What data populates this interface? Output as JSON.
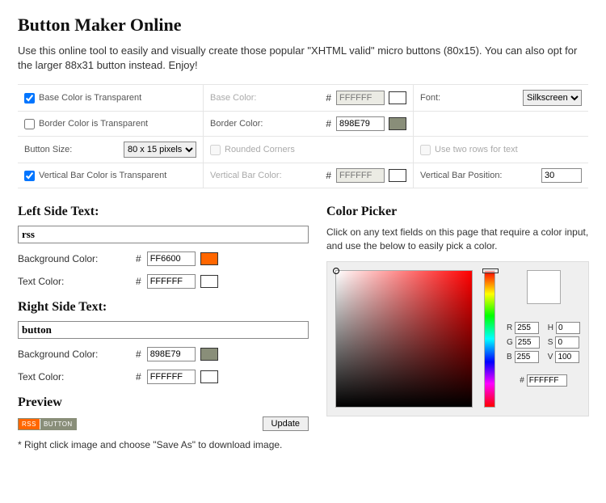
{
  "title": "Button Maker Online",
  "intro": "Use this online tool to easily and visually create those popular \"XHTML valid\" micro buttons (80x15). You can also opt for the larger 88x31 button instead. Enjoy!",
  "options": {
    "base_transparent_label": "Base Color is Transparent",
    "base_transparent": true,
    "base_color_label": "Base Color:",
    "base_color": "FFFFFF",
    "font_label": "Font:",
    "font_value": "Silkscreen",
    "border_transparent_label": "Border Color is Transparent",
    "border_transparent": false,
    "border_color_label": "Border Color:",
    "border_color": "898E79",
    "size_label": "Button Size:",
    "size_value": "80 x 15 pixels",
    "rounded_label": "Rounded Corners",
    "rounded": false,
    "two_rows_label": "Use two rows for text",
    "two_rows": false,
    "vbar_transparent_label": "Vertical Bar Color is Transparent",
    "vbar_transparent": true,
    "vbar_color_label": "Vertical Bar Color:",
    "vbar_color": "FFFFFF",
    "vbar_pos_label": "Vertical Bar Position:",
    "vbar_pos": "30"
  },
  "left": {
    "heading": "Left Side Text:",
    "text": "rss",
    "bg_label": "Background Color:",
    "bg": "FF6600",
    "tc_label": "Text Color:",
    "tc": "FFFFFF"
  },
  "right": {
    "heading": "Right Side Text:",
    "text": "button",
    "bg_label": "Background Color:",
    "bg": "898E79",
    "tc_label": "Text Color:",
    "tc": "FFFFFF"
  },
  "preview": {
    "heading": "Preview",
    "left_text": "RSS",
    "right_text": "BUTTON",
    "update": "Update",
    "note": "* Right click image and choose \"Save As\" to download image."
  },
  "picker": {
    "heading": "Color Picker",
    "desc": "Click on any text fields on this page that require a color input, and use the below to easily pick a color.",
    "r": "255",
    "g": "255",
    "b": "255",
    "h": "0",
    "s": "0",
    "v": "100",
    "hex": "FFFFFF",
    "r_label": "R",
    "g_label": "G",
    "b_label": "B",
    "h_label": "H",
    "s_label": "S",
    "v_label": "V",
    "hash": "#"
  }
}
